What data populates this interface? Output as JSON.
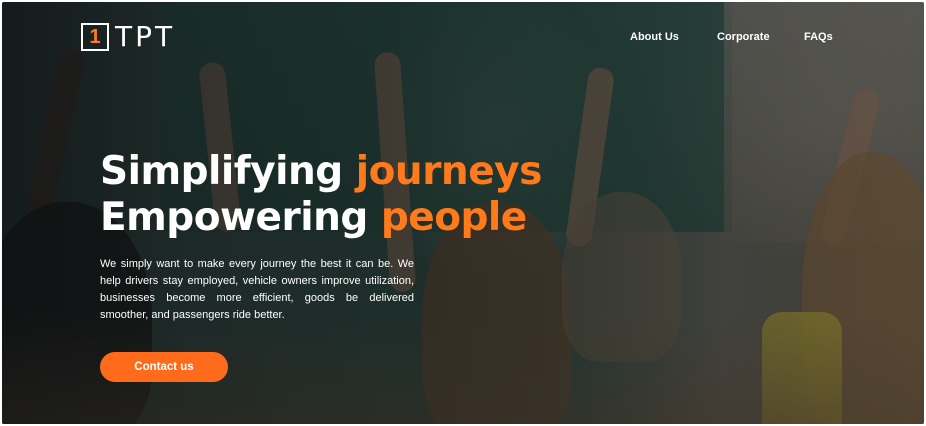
{
  "brand": {
    "logo_number": "1",
    "logo_text": "TPT",
    "accent_color": "#ff7a1a"
  },
  "nav": {
    "items": [
      {
        "label": "About Us"
      },
      {
        "label": "Corporate"
      },
      {
        "label": "FAQs"
      }
    ]
  },
  "hero": {
    "line1_main": "Simplifying ",
    "line1_accent": "journeys",
    "line2_main": "Empowering ",
    "line2_accent": "people",
    "description": "We simply want to make every journey the best it can be. We help drivers stay employed, vehicle owners improve utilization, businesses become more efficient, goods be delivered smoother, and passengers ride better.",
    "cta_label": "Contact us",
    "background_image": "classroom-children-raising-hands"
  }
}
